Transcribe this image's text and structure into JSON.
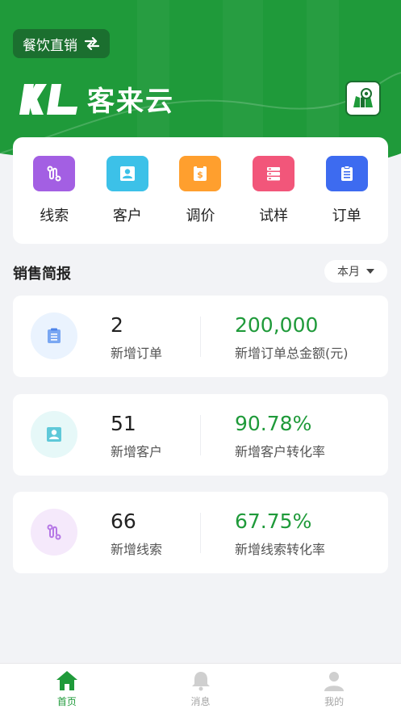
{
  "header": {
    "mode_label": "餐饮直销",
    "brand_name": "客来云",
    "colors": {
      "primary": "#1f9a3a",
      "primary_dark": "#1b6f2f"
    }
  },
  "quick_actions": [
    {
      "label": "线索",
      "icon": "lead-icon",
      "color": "#a35fe3"
    },
    {
      "label": "客户",
      "icon": "customer-icon",
      "color": "#3cc1e8"
    },
    {
      "label": "调价",
      "icon": "price-icon",
      "color": "#ff9f2e"
    },
    {
      "label": "试样",
      "icon": "sample-icon",
      "color": "#f2567a"
    },
    {
      "label": "订单",
      "icon": "order-icon",
      "color": "#3d6bf0"
    }
  ],
  "sales_report": {
    "title": "销售简报",
    "period": "本月",
    "stats": [
      {
        "icon": "order-icon",
        "count": "2",
        "count_label": "新增订单",
        "metric": "200,000",
        "metric_label": "新增订单总金额(元)"
      },
      {
        "icon": "customer-icon",
        "count": "51",
        "count_label": "新增客户",
        "metric": "90.78%",
        "metric_label": "新增客户转化率"
      },
      {
        "icon": "lead-icon",
        "count": "66",
        "count_label": "新增线索",
        "metric": "67.75%",
        "metric_label": "新增线索转化率"
      }
    ]
  },
  "tabbar": [
    {
      "label": "首页",
      "icon": "home-icon",
      "active": true
    },
    {
      "label": "消息",
      "icon": "bell-icon",
      "active": false
    },
    {
      "label": "我的",
      "icon": "user-icon",
      "active": false
    }
  ]
}
